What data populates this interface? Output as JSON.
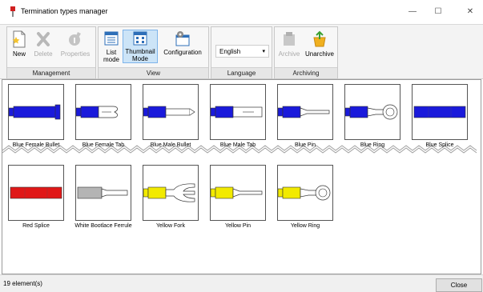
{
  "window": {
    "title": "Termination types manager",
    "minimize": "—",
    "maximize": "☐",
    "close": "✕"
  },
  "ribbon": {
    "management": {
      "caption": "Management",
      "new_label": "New",
      "delete_label": "Delete",
      "properties_label": "Properties"
    },
    "view": {
      "caption": "View",
      "list_label": "List mode",
      "thumbnail_label": "Thumbnail Mode",
      "configuration_label": "Configuration"
    },
    "language": {
      "caption": "Language",
      "value": "English"
    },
    "archiving": {
      "caption": "Archiving",
      "archive_label": "Archive",
      "unarchive_label": "Unarchive"
    }
  },
  "items": [
    {
      "label": "Blue Female Bullet",
      "kind": "female-bullet",
      "color": "#1a1adb"
    },
    {
      "label": "Blue Female Tab",
      "kind": "female-tab",
      "color": "#1a1adb"
    },
    {
      "label": "Blue Male Bullet",
      "kind": "male-bullet",
      "color": "#1a1adb"
    },
    {
      "label": "Blue Male Tab",
      "kind": "male-tab",
      "color": "#1a1adb"
    },
    {
      "label": "Blue Pin",
      "kind": "pin",
      "color": "#1a1adb"
    },
    {
      "label": "Blue Ring",
      "kind": "ring",
      "color": "#1a1adb"
    },
    {
      "label": "Blue Splice",
      "kind": "splice",
      "color": "#1a1adb"
    },
    {
      "label": "Red Splice",
      "kind": "splice",
      "color": "#e01818"
    },
    {
      "label": "White Bootlace Ferrule",
      "kind": "ferrule",
      "color": "#b4b4b4"
    },
    {
      "label": "Yellow Fork",
      "kind": "fork",
      "color": "#f2ea00"
    },
    {
      "label": "Yellow Pin",
      "kind": "pin",
      "color": "#f2ea00"
    },
    {
      "label": "Yellow Ring",
      "kind": "ring",
      "color": "#f2ea00"
    }
  ],
  "status": {
    "count": "19 element(s)",
    "close_label": "Close"
  }
}
